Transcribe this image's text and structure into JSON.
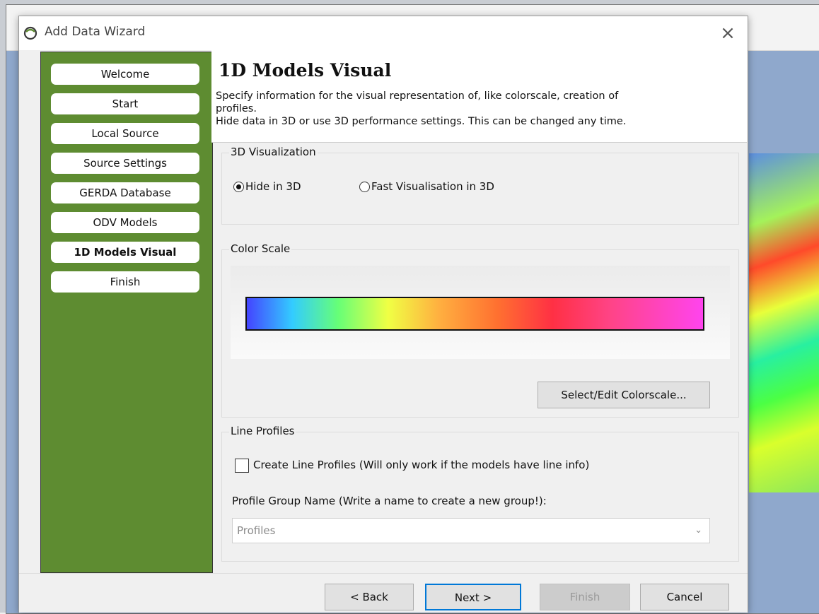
{
  "dialog": {
    "title": "Add Data Wizard",
    "close_glyph": "×"
  },
  "nav": {
    "items": [
      {
        "label": "Welcome",
        "active": false
      },
      {
        "label": "Start",
        "active": false
      },
      {
        "label": "Local Source",
        "active": false
      },
      {
        "label": "Source Settings",
        "active": false
      },
      {
        "label": "GERDA Database",
        "active": false
      },
      {
        "label": "ODV Models",
        "active": false
      },
      {
        "label": "1D Models Visual",
        "active": true
      },
      {
        "label": "Finish",
        "active": false
      }
    ]
  },
  "header": {
    "title": "1D Models Visual",
    "description_line1": "Specify information for the visual representation of, like colorscale, creation of",
    "description_line2": "profiles.",
    "description_line3": "Hide data in 3D or use 3D performance settings. This can be changed any time."
  },
  "viz3d": {
    "group_title": "3D Visualization",
    "options": [
      {
        "label": "Hide in 3D",
        "selected": true
      },
      {
        "label": "Fast Visualisation in 3D",
        "selected": false
      }
    ]
  },
  "colorscale": {
    "group_title": "Color Scale",
    "edit_button": "Select/Edit Colorscale...",
    "stops": [
      "#4444ff",
      "#33ccff",
      "#66ff77",
      "#f0ff44",
      "#ffb040",
      "#ff7030",
      "#ff3044",
      "#ff4488",
      "#ff44ee"
    ]
  },
  "profiles": {
    "group_title": "Line Profiles",
    "checkbox_label": "Create Line Profiles (Will only work if the models have line info)",
    "checkbox_checked": false,
    "group_name_label": "Profile Group Name (Write a name to create a new group!):",
    "group_name_value": "Profiles"
  },
  "footer": {
    "back_label": "< Back",
    "next_label": "Next >",
    "finish_label": "Finish",
    "cancel_label": "Cancel"
  }
}
